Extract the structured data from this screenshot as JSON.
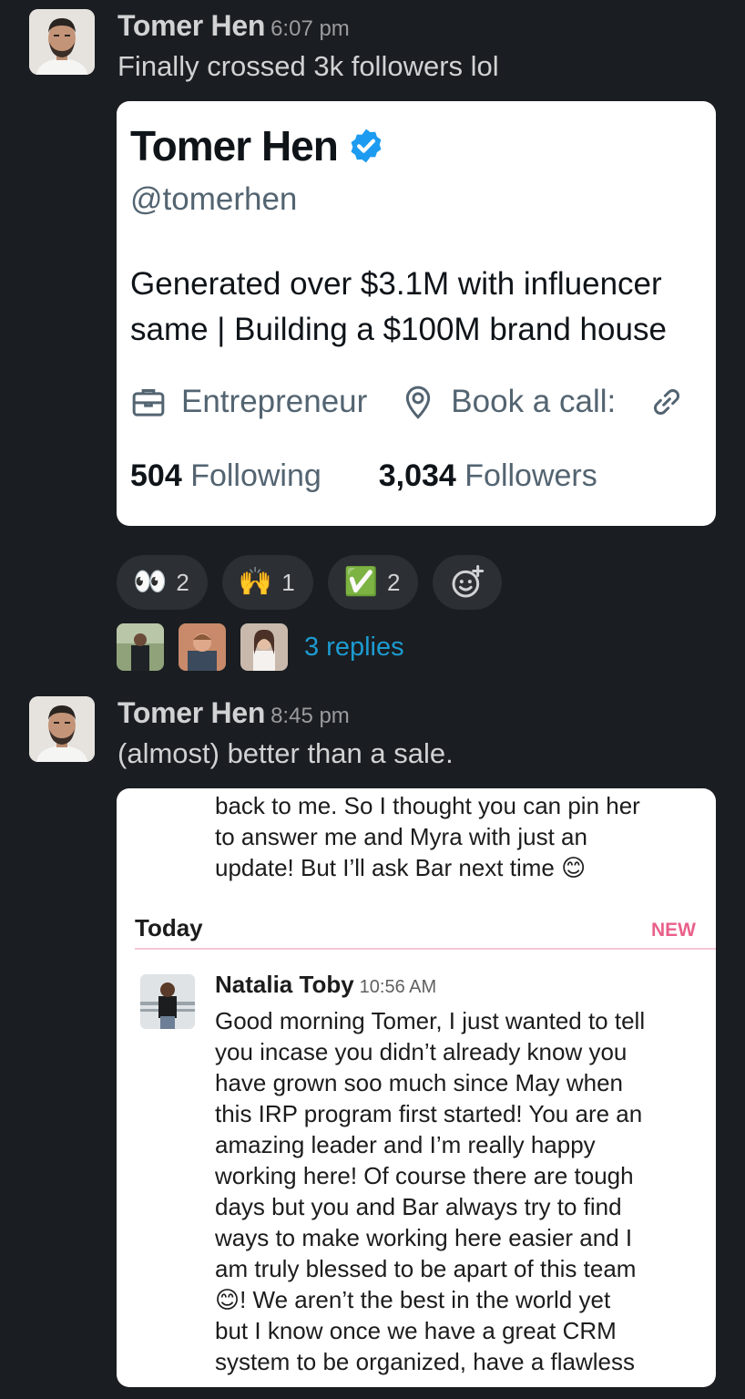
{
  "message1": {
    "author": "Tomer Hen",
    "time": "6:07 pm",
    "text": "Finally crossed 3k followers lol",
    "profile_card": {
      "name": "Tomer Hen",
      "handle": "@tomerhen",
      "bio_line1": "Generated over $3.1M with influencer",
      "bio_line2": "same | Building a $100M brand house",
      "category": "Entrepreneur",
      "location": "Book a call:",
      "following_count": "504",
      "following_label": "Following",
      "followers_count": "3,034",
      "followers_label": "Followers"
    },
    "reactions": [
      {
        "emoji": "👀",
        "count": "2"
      },
      {
        "emoji": "🙌",
        "count": "1"
      },
      {
        "emoji": "✅",
        "count": "2"
      }
    ],
    "replies_label": "3 replies"
  },
  "message2": {
    "author": "Tomer Hen",
    "time": "8:45 pm",
    "text": "(almost) better than a sale.",
    "screenshot": {
      "previous_lines": [
        "back to me. So I thought you can pin her",
        "to answer me and Myra with just an",
        "update! But I’ll ask Bar next time 😊"
      ],
      "divider_label": "Today",
      "new_label": "NEW",
      "author": "Natalia Toby",
      "time": "10:56 AM",
      "body_lines": [
        "Good morning Tomer, I just wanted to tell",
        "you incase you didn’t already know you",
        "have grown soo much since May when",
        "this IRP program first started! You are an",
        "amazing leader and I’m really happy",
        "working here! Of course there are tough",
        "days but you and Bar always try to find",
        "ways to make working here easier and I",
        "am truly blessed to be apart of this team",
        "😊! We aren’t the best in the world yet",
        "but I know once we have a great CRM",
        "system to be organized, have a flawless"
      ]
    }
  },
  "colors": {
    "background": "#1a1d21",
    "link": "#1d9bd1",
    "verified": "#1d9bf0",
    "new_badge": "#e01e5a"
  }
}
